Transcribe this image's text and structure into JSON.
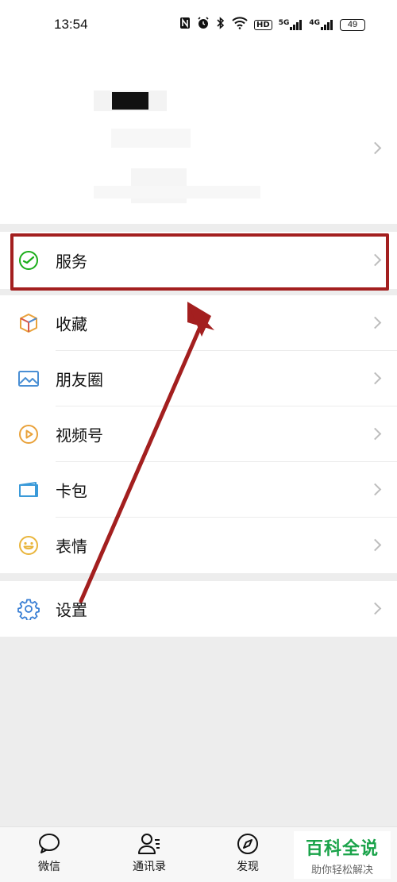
{
  "status_bar": {
    "time": "13:54",
    "icons": [
      "nfc-icon",
      "alarm-icon",
      "bluetooth-icon",
      "wifi-icon",
      "hd-icon",
      "signal-5g-icon",
      "signal-4g-icon"
    ],
    "network_1": "5G",
    "network_2": "4G",
    "hd": "HD",
    "battery": "49"
  },
  "menu": {
    "services": "服务",
    "favorites": "收藏",
    "moments": "朋友圈",
    "channels": "视频号",
    "cards": "卡包",
    "stickers": "表情",
    "settings": "设置"
  },
  "tabbar": {
    "chats": "微信",
    "contacts": "通讯录",
    "discover": "发现"
  },
  "watermark": {
    "title": "百科全说",
    "subtitle": "助你轻松解决"
  },
  "colors": {
    "highlight": "#a31f1f",
    "watermark_green": "#1aa34a",
    "services_icon": "#1aad19",
    "favorites_icon": "#e9a23b",
    "moments_icon": "#4a8fd4",
    "channels_icon": "#e9a23b",
    "cards_icon": "#3a9ad9",
    "stickers_icon": "#e9b53b",
    "settings_icon": "#3a7fd4"
  }
}
